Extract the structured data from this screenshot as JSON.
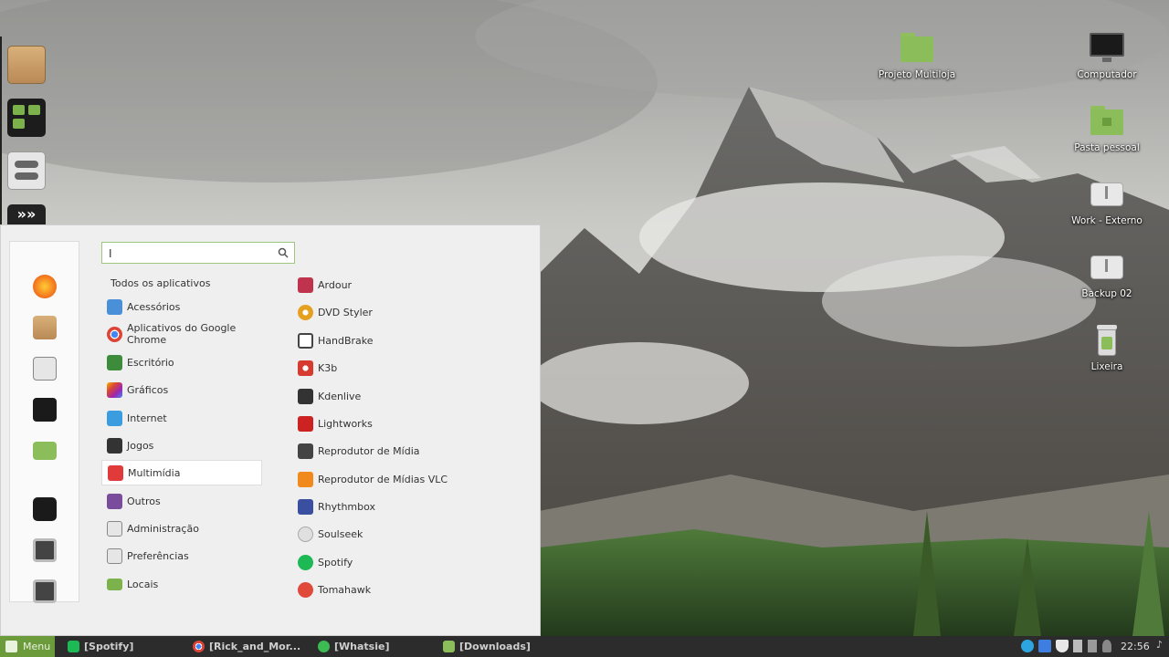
{
  "desktop": {
    "icons": [
      {
        "label": "Projeto Multiloja",
        "icon": "folder-icon"
      },
      {
        "label": "Computador",
        "icon": "computer-icon"
      },
      {
        "label": "Pasta pessoal",
        "icon": "home-folder-icon"
      },
      {
        "label": "Work - Externo",
        "icon": "usb-drive-icon"
      },
      {
        "label": "Backup 02",
        "icon": "usb-drive-icon"
      },
      {
        "label": "Lixeira",
        "icon": "trash-icon"
      }
    ]
  },
  "dock": {
    "items": [
      "package-icon",
      "file-manager-icon",
      "settings-toggle-icon",
      "media-icon"
    ]
  },
  "menu": {
    "search": {
      "value": "I"
    },
    "all_apps_label": "Todos os aplicativos",
    "favorites": [
      "firefox-icon",
      "package-icon",
      "settings-icon",
      "terminal-icon",
      "folder-icon",
      "lock-icon",
      "logout-icon",
      "shutdown-icon"
    ],
    "categories": [
      {
        "label": "Acessórios",
        "icon": "accessories-icon",
        "color": "#4a90d9"
      },
      {
        "label": "Aplicativos do Google Chrome",
        "icon": "chrome-icon",
        "color": "#db4437"
      },
      {
        "label": "Escritório",
        "icon": "office-icon",
        "color": "#3c8c3c"
      },
      {
        "label": "Gráficos",
        "icon": "graphics-icon",
        "color": "#d94f9c"
      },
      {
        "label": "Internet",
        "icon": "internet-icon",
        "color": "#3b9de0"
      },
      {
        "label": "Jogos",
        "icon": "games-icon",
        "color": "#333333"
      },
      {
        "label": "Multimídia",
        "icon": "multimedia-icon",
        "color": "#e03a3a",
        "active": true
      },
      {
        "label": "Outros",
        "icon": "others-icon",
        "color": "#7a4c9c"
      },
      {
        "label": "Administração",
        "icon": "administration-icon",
        "color": "#777777"
      },
      {
        "label": "Preferências",
        "icon": "preferences-icon",
        "color": "#777777"
      },
      {
        "label": "Locais",
        "icon": "places-icon",
        "color": "#7bb24c"
      }
    ],
    "apps": [
      {
        "label": "Ardour",
        "icon": "ardour-icon",
        "color": "#c0334e"
      },
      {
        "label": "DVD Styler",
        "icon": "dvdstyler-icon",
        "color": "#e6a020"
      },
      {
        "label": "HandBrake",
        "icon": "handbrake-icon",
        "color": "#444444"
      },
      {
        "label": "K3b",
        "icon": "k3b-icon",
        "color": "#d63b2f"
      },
      {
        "label": "Kdenlive",
        "icon": "kdenlive-icon",
        "color": "#333333"
      },
      {
        "label": "Lightworks",
        "icon": "lightworks-icon",
        "color": "#cc2222"
      },
      {
        "label": "Reprodutor de Mídia",
        "icon": "media-player-icon",
        "color": "#444444"
      },
      {
        "label": "Reprodutor de Mídias VLC",
        "icon": "vlc-icon",
        "color": "#f08a1c"
      },
      {
        "label": "Rhythmbox",
        "icon": "rhythmbox-icon",
        "color": "#3a4fa0"
      },
      {
        "label": "Soulseek",
        "icon": "soulseek-icon",
        "color": "#aaaaaa"
      },
      {
        "label": "Spotify",
        "icon": "spotify-icon",
        "color": "#1db954"
      },
      {
        "label": "Tomahawk",
        "icon": "tomahawk-icon",
        "color": "#e04a3a"
      }
    ]
  },
  "taskbar": {
    "menu_label": "Menu",
    "tasks": [
      {
        "label": "[Spotify]",
        "icon": "spotify-icon",
        "color": "#1db954"
      },
      {
        "label": "[Rick_and_Mor...",
        "icon": "chrome-icon",
        "color": "#db4437"
      },
      {
        "label": "[Whatsie]",
        "icon": "whatsie-icon",
        "color": "#3cba54"
      },
      {
        "label": "[Downloads]",
        "icon": "folder-icon",
        "color": "#8bbd5a"
      }
    ],
    "tray": [
      "telegram-icon",
      "dropbox-icon",
      "shield-icon",
      "clipboard-icon",
      "network-icon",
      "user-icon",
      "brush-icon"
    ],
    "clock": "22:56"
  }
}
